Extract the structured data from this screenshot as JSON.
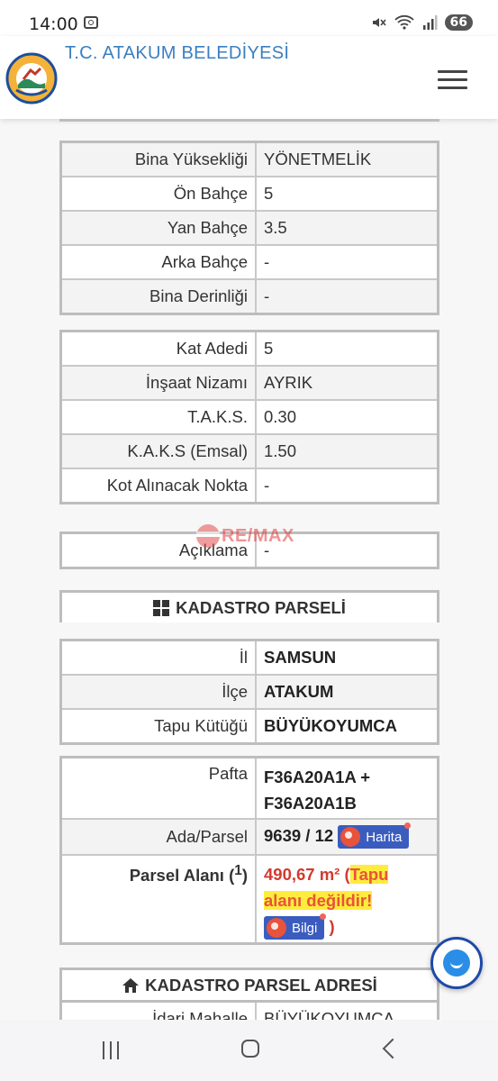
{
  "status_bar": {
    "time": "14:00",
    "battery": "66"
  },
  "header": {
    "title": "T.C. ATAKUM BELEDİYESİ"
  },
  "setbacks": [
    {
      "label": "Bina Yüksekliği",
      "value": "YÖNETMELİK"
    },
    {
      "label": "Ön Bahçe",
      "value": "5"
    },
    {
      "label": "Yan Bahçe",
      "value": "3.5"
    },
    {
      "label": "Arka Bahçe",
      "value": "-"
    },
    {
      "label": "Bina Derinliği",
      "value": "-"
    }
  ],
  "construction": [
    {
      "label": "Kat Adedi",
      "value": "5"
    },
    {
      "label": "İnşaat Nizamı",
      "value": "AYRIK"
    },
    {
      "label": "T.A.K.S.",
      "value": "0.30"
    },
    {
      "label": "K.A.K.S (Emsal)",
      "value": "1.50"
    },
    {
      "label": "Kot Alınacak Nokta",
      "value": "-"
    }
  ],
  "description": {
    "label": "Açıklama",
    "value": "-"
  },
  "watermark": {
    "text": "RE/MAX"
  },
  "cadastre": {
    "heading": "KADASTRO PARSELİ",
    "location": [
      {
        "label": "İl",
        "value": "SAMSUN"
      },
      {
        "label": "İlçe",
        "value": "ATAKUM"
      },
      {
        "label": "Tapu Kütüğü",
        "value": "BÜYÜKOYUMCA"
      }
    ],
    "pafta_label": "Pafta",
    "pafta_value_1": "F36A20A1A +",
    "pafta_value_2": "F36A20A1B",
    "ada_label": "Ada/Parsel",
    "ada_value": "9639 / 12",
    "map_button": "Harita",
    "area_label": "Parsel Alanı (",
    "area_sup": "1",
    "area_label_end": ")",
    "area_value": "490,67 m² (",
    "area_note_1": "Tapu",
    "area_note_2": "alanı değildir!",
    "info_button": "Bilgi",
    "area_close": " )"
  },
  "address": {
    "heading": "KADASTRO PARSEL ADRESİ",
    "first_row_label": "İdari Mahalle",
    "first_row_value": "BÜYÜKOYUMCA"
  }
}
